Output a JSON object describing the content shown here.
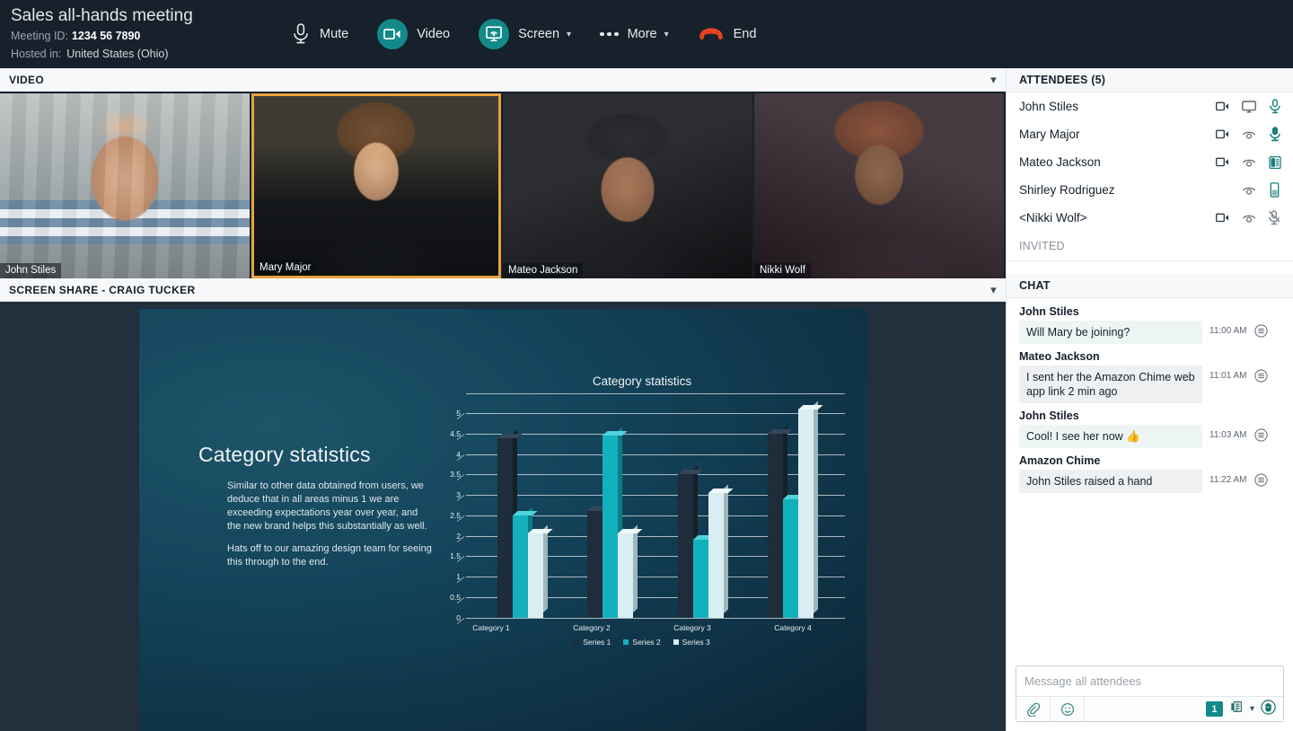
{
  "header": {
    "meeting_title": "Sales all-hands meeting",
    "meeting_id_label": "Meeting ID:",
    "meeting_id": "1234 56 7890",
    "hosted_label": "Hosted in:",
    "hosted_value": "United States (Ohio)",
    "controls": [
      {
        "label": "Mute",
        "icon": "microphone-icon",
        "style": "plain",
        "caret": false
      },
      {
        "label": "Video",
        "icon": "video-camera-icon",
        "style": "circle",
        "caret": false
      },
      {
        "label": "Screen",
        "icon": "screen-share-icon",
        "style": "circle",
        "caret": true
      },
      {
        "label": "More",
        "icon": "ellipsis-icon",
        "style": "dots",
        "caret": true
      },
      {
        "label": "End",
        "icon": "hangup-phone-icon",
        "style": "danger",
        "caret": false
      }
    ]
  },
  "sections": {
    "video_title": "VIDEO",
    "screenshare_title": "SCREEN SHARE - CRAIG TUCKER",
    "collapse_icon": "chevron-down-icon"
  },
  "video_tiles": [
    {
      "name": "John Stiles",
      "active": false,
      "cam": "cam1"
    },
    {
      "name": "Mary Major",
      "active": true,
      "cam": "cam2"
    },
    {
      "name": "Mateo Jackson",
      "active": false,
      "cam": "cam3"
    },
    {
      "name": "Nikki Wolf",
      "active": false,
      "cam": "cam4"
    }
  ],
  "slide": {
    "heading": "Category statistics",
    "paragraphs": [
      "Similar to other data obtained from users, we deduce that in all areas minus 1 we are exceeding expectations year over year, and the new brand helps this substantially as well.",
      "Hats off to our amazing design team for seeing this through to the end."
    ]
  },
  "chart_data": {
    "type": "bar",
    "title": "Category statistics",
    "categories": [
      "Category 1",
      "Category 2",
      "Category 3",
      "Category 4"
    ],
    "series": [
      {
        "name": "Series 1",
        "color": "#1f2c3a",
        "values": [
          4.4,
          2.6,
          3.5,
          4.5
        ]
      },
      {
        "name": "Series 2",
        "color": "#13b0bd",
        "values": [
          2.5,
          4.45,
          1.9,
          2.9
        ]
      },
      {
        "name": "Series 3",
        "color": "#d8eef2",
        "values": [
          2.05,
          2.05,
          3.05,
          5.1
        ]
      }
    ],
    "yticks": [
      "0",
      "0.5",
      "1",
      "1.5",
      "2",
      "2.5",
      "3",
      "3.5",
      "4",
      "4.5",
      "5"
    ],
    "ylim": [
      0,
      5.5
    ],
    "xlabel": "",
    "ylabel": "",
    "grid": true,
    "legend_position": "bottom"
  },
  "attendees": {
    "header": "ATTENDEES (5)",
    "invited_header": "INVITED",
    "rows": [
      {
        "name": "John Stiles",
        "video": "video-camera-icon",
        "presence": "screen-monitor-icon",
        "audio": "microphone-icon",
        "audio_state": "open"
      },
      {
        "name": "Mary Major",
        "video": "video-camera-icon",
        "presence": "eye-presence-icon",
        "audio": "microphone-active-icon",
        "audio_state": "active"
      },
      {
        "name": "Mateo Jackson",
        "video": "video-camera-icon",
        "presence": "eye-presence-icon",
        "audio": "desk-phone-icon",
        "audio_state": "phone"
      },
      {
        "name": "Shirley Rodriguez",
        "video": "",
        "presence": "eye-presence-icon",
        "audio": "mobile-phone-icon",
        "audio_state": "mobile"
      },
      {
        "name": "<Nikki Wolf>",
        "video": "video-camera-icon",
        "presence": "eye-presence-icon",
        "audio": "microphone-muted-icon",
        "audio_state": "muted"
      }
    ]
  },
  "chat": {
    "header": "CHAT",
    "messages": [
      {
        "author": "John Stiles",
        "text": "Will Mary be joining?",
        "time": "11:00 AM",
        "self": true,
        "options_icon": "message-options-icon"
      },
      {
        "author": "Mateo Jackson",
        "text": "I sent her the Amazon Chime web app link 2 min ago",
        "time": "11:01 AM",
        "self": false,
        "options_icon": "message-options-icon"
      },
      {
        "author": "John Stiles",
        "text": "Cool! I see her now 👍",
        "time": "11:03 AM",
        "self": true,
        "options_icon": "message-options-icon"
      },
      {
        "author": "Amazon Chime",
        "text": "John Stiles raised a hand",
        "time": "11:22 AM",
        "self": false,
        "options_icon": "message-options-icon"
      }
    ],
    "composer": {
      "placeholder": "Message all attendees",
      "attach_icon": "paperclip-icon",
      "emoji_icon": "smiley-icon",
      "badge_count": "1",
      "attendee_list_icon": "attendee-list-icon",
      "caret_icon": "chevron-down-icon",
      "raise_hand_icon": "raise-hand-icon"
    }
  },
  "colors": {
    "header_bg": "#17212c",
    "accent_teal": "#138a8a",
    "danger_red": "#e8421e",
    "active_tile_border": "#e8a33d",
    "panel_bg": "#f7f8f9"
  }
}
